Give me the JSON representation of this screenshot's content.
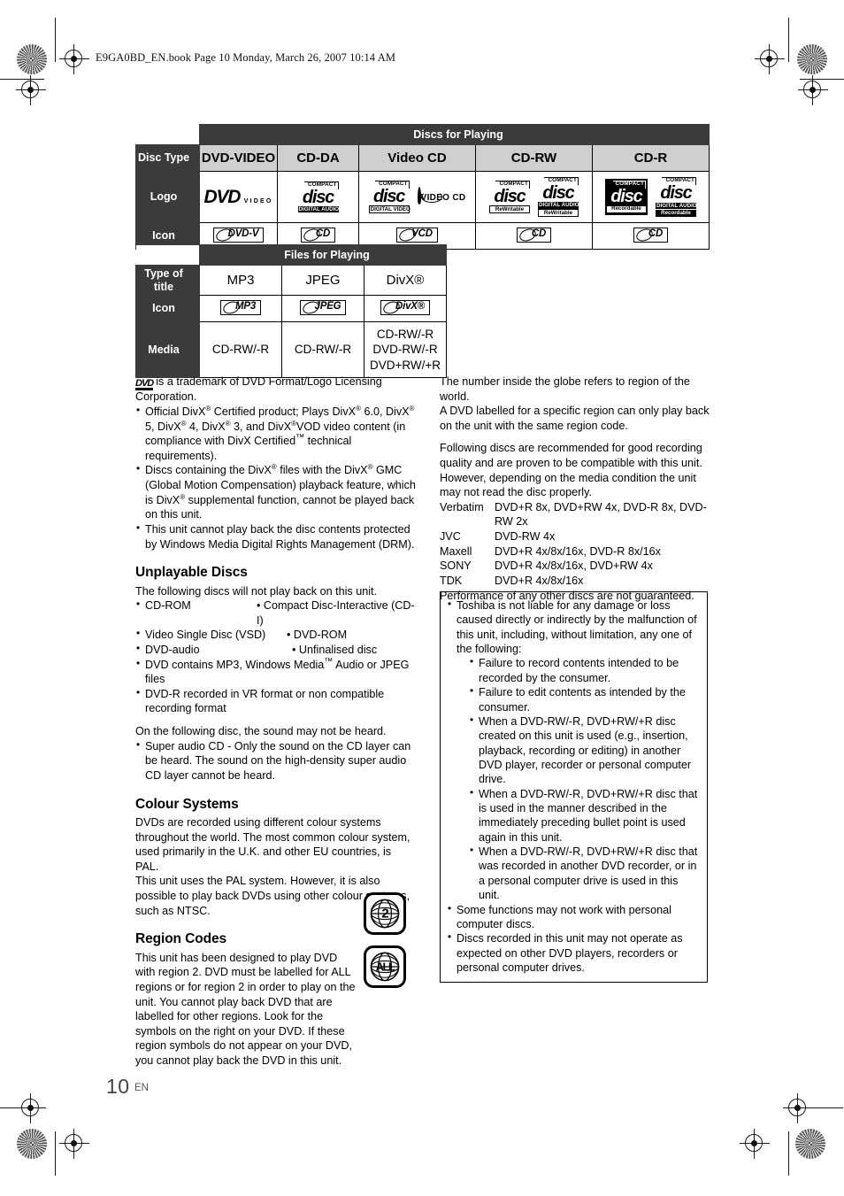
{
  "header": {
    "book_line": "E9GA0BD_EN.book  Page 10  Monday, March 26, 2007  10:14 AM"
  },
  "footer": {
    "page_number": "10",
    "language": "EN"
  },
  "discs_table": {
    "banner": "Discs for Playing",
    "row_labels": [
      "Disc Type",
      "Logo",
      "Icon"
    ],
    "disc_types": [
      "DVD-VIDEO",
      "CD-DA",
      "Video CD",
      "CD-RW",
      "CD-R"
    ],
    "logos": [
      [
        "DVD VIDEO"
      ],
      [
        "COMPACT disc DIGITAL AUDIO"
      ],
      [
        "COMPACT disc DIGITAL VIDEO",
        "VIDEO CD"
      ],
      [
        "COMPACT disc ReWritable",
        "COMPACT disc DIGITAL AUDIO ReWritable"
      ],
      [
        "COMPACT disc Recordable",
        "COMPACT disc DIGITAL AUDIO Recordable"
      ]
    ],
    "logo_parts": {
      "dvd_word": "DVD",
      "dvd_sub": "VIDEO",
      "compact": "COMPACT",
      "disc": "disc",
      "digital_audio": "DIGITAL AUDIO",
      "digital_video": "DIGITAL VIDEO",
      "rewritable": "ReWritable",
      "recordable": "Recordable",
      "video_cd": "VIDEO CD"
    },
    "icons": [
      "DVD-V",
      "CD",
      "VCD",
      "CD",
      "CD"
    ]
  },
  "files_table": {
    "banner": "Files for Playing",
    "row_labels": [
      "Type of title",
      "Icon",
      "Media"
    ],
    "types": [
      "MP3",
      "JPEG",
      "DivX®"
    ],
    "icons": [
      "MP3",
      "JPEG",
      "DivX®"
    ],
    "media": [
      "CD-RW/-R",
      "CD-RW/-R",
      "CD-RW/-R\nDVD-RW/-R\nDVD+RW/+R"
    ]
  },
  "left_column": {
    "trademark_note": "is a trademark of DVD Format/Logo Licensing Corporation.",
    "bullets": [
      "Official DivX® Certified product; Plays DivX® 6.0, DivX® 5, DivX® 4, DivX® 3, and DivX®VOD video content (in compliance with DivX Certified™ technical requirements).",
      "Discs containing the DivX® files with the DivX® GMC (Global Motion Compensation) playback feature, which is DivX® supplemental function, cannot be played back on this unit."
    ],
    "star_note": "This unit cannot play back the disc contents protected by Windows Media Digital Rights Management (DRM).",
    "unplayable": {
      "heading": "Unplayable Discs",
      "intro": "The following discs will not play back on this unit.",
      "pairs": [
        [
          "CD-ROM",
          "Compact Disc-Interactive (CD-I)"
        ],
        [
          "Video Single Disc (VSD)",
          "DVD-ROM"
        ],
        [
          "DVD-audio",
          "Unfinalised disc"
        ]
      ],
      "extra_bullets": [
        "DVD contains MP3, Windows Media™ Audio or JPEG files",
        "DVD-R recorded in VR format or non compatible recording format"
      ],
      "sound_intro": "On the following disc, the sound may not be heard.",
      "sound_bullet": "Super audio CD - Only the sound on the CD layer can be heard. The sound on the high-density super audio CD layer cannot be heard."
    },
    "colour_systems": {
      "heading": "Colour Systems",
      "paragraph1": "DVDs are recorded using different colour systems throughout the world. The most common colour system, used primarily in the U.K. and other EU countries, is PAL.",
      "paragraph2": "This unit uses the PAL system. However, it is also possible to play back DVDs using other colour systems, such as NTSC."
    },
    "region_codes": {
      "heading": "Region Codes",
      "paragraph": "This unit has been designed to play DVD with region 2. DVD must be labelled for ALL regions or for region 2 in order to play on the unit. You cannot play back DVD that are labelled for other regions. Look for the symbols on the right on your DVD. If these region symbols do not appear on your DVD, you cannot play back the DVD in this unit.",
      "symbols": [
        "2",
        "ALL"
      ]
    }
  },
  "right_column": {
    "globe_note1": "The number inside the globe refers to region of the world.",
    "globe_note2": "A DVD labelled for a specific region can only play back on the unit with the same region code.",
    "recommend_intro": "Following discs are recommended for good recording quality and are proven to be compatible with this unit. However, depending on the media condition the unit may not read the disc properly.",
    "brands": [
      {
        "name": "Verbatim",
        "specs": "DVD+R 8x, DVD+RW 4x, DVD-R 8x, DVD-RW 2x"
      },
      {
        "name": "JVC",
        "specs": "DVD-RW 4x"
      },
      {
        "name": "Maxell",
        "specs": "DVD+R 4x/8x/16x, DVD-R 8x/16x"
      },
      {
        "name": "SONY",
        "specs": "DVD+R 4x/8x/16x, DVD+RW 4x"
      },
      {
        "name": "TDK",
        "specs": "DVD+R 4x/8x/16x"
      }
    ],
    "performance_note": "Performance of any other discs are not guaranteed.",
    "notice": {
      "main_bullet": "Toshiba is not liable for any damage or loss caused directly or indirectly by the malfunction of this unit, including, without limitation, any one of the following:",
      "sub_bullets": [
        "Failure to record contents intended to be recorded by the consumer.",
        "Failure to edit contents as intended by the consumer.",
        "When a DVD-RW/-R, DVD+RW/+R disc created on this unit is used (e.g., insertion, playback, recording or editing) in another DVD player, recorder or personal computer drive.",
        "When a DVD-RW/-R, DVD+RW/+R disc that is used in the manner described in the immediately preceding bullet point is used again in this unit.",
        "When a DVD-RW/-R, DVD+RW/+R disc that was recorded in another DVD recorder, or in a personal computer drive is used in this unit."
      ],
      "tail_bullets": [
        "Some functions may not work with personal computer discs.",
        "Discs recorded in this unit may not operate as expected on other DVD players, recorders or personal computer drives."
      ]
    }
  },
  "colors": {
    "header_dark": "#3b3b3b",
    "column_header_grey": "#cfcfcf",
    "page_background": "#ffffff",
    "text": "#000000"
  }
}
